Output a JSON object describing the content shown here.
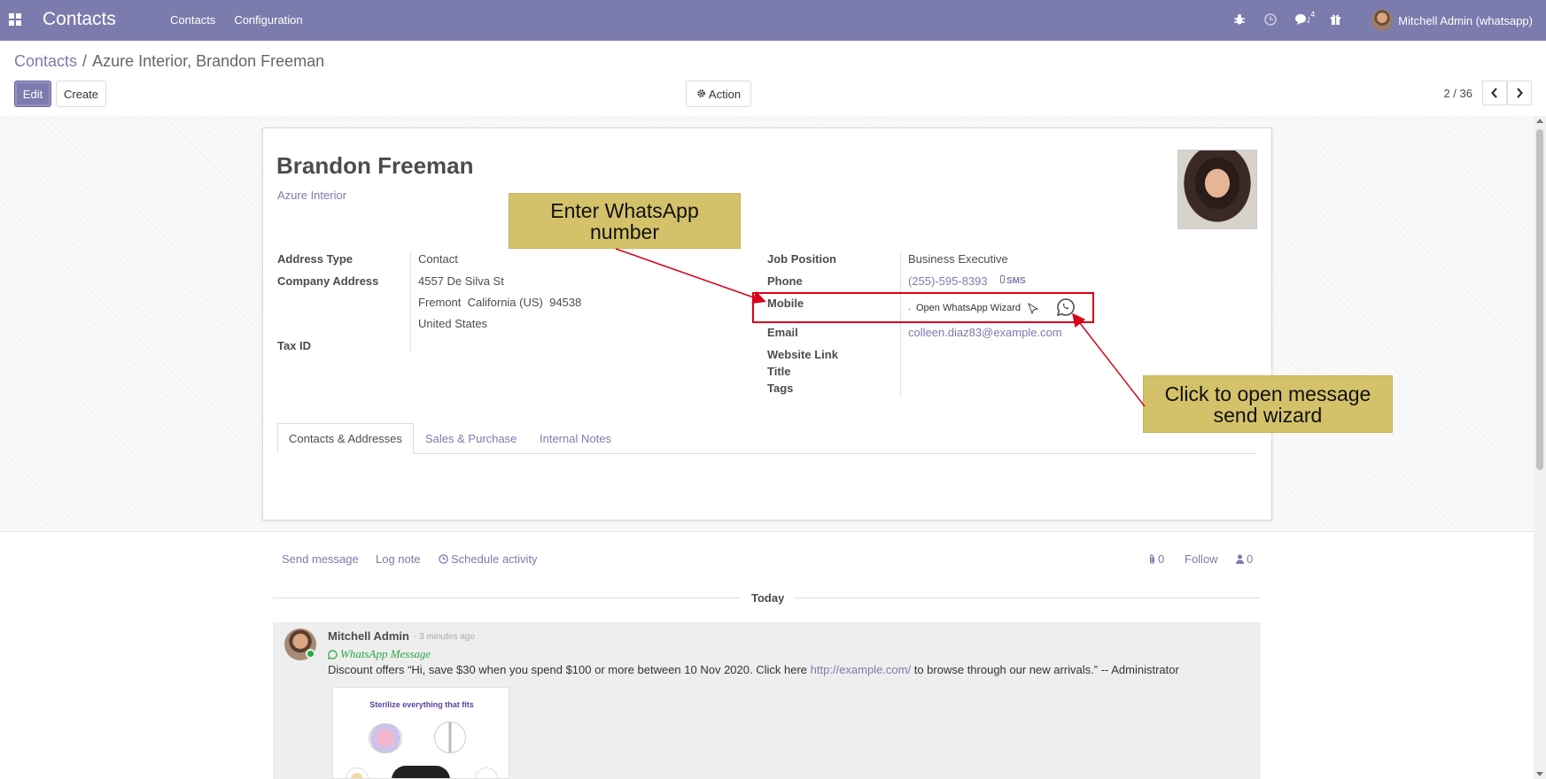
{
  "navbar": {
    "app_name": "Contacts",
    "menu": [
      "Contacts",
      "Configuration"
    ],
    "messages_count": "4",
    "user_name": "Mitchell Admin (whatsapp)"
  },
  "control_panel": {
    "breadcrumb_root": "Contacts",
    "breadcrumb_separator": "/",
    "breadcrumb_current": "Azure Interior, Brandon Freeman",
    "edit_label": "Edit",
    "create_label": "Create",
    "action_label": "Action",
    "pager": "2 / 36"
  },
  "form": {
    "name": "Brandon Freeman",
    "company": "Azure Interior",
    "left_fields": {
      "address_type_label": "Address Type",
      "address_type_value": "Contact",
      "company_address_label": "Company Address",
      "street": "4557 De Silva St",
      "city_line": "Fremont  California (US)  94538",
      "country": "United States",
      "tax_id_label": "Tax ID"
    },
    "right_fields": {
      "job_position_label": "Job Position",
      "job_position_value": "Business Executive",
      "phone_label": "Phone",
      "phone_value": "(255)-595-8393",
      "sms_label": "SMS",
      "mobile_label": "Mobile",
      "mobile_prefix": ".",
      "open_whatsapp_wizard": "Open WhatsApp Wizard",
      "email_label": "Email",
      "email_value": "colleen.diaz83@example.com",
      "website_label": "Website Link",
      "title_label": "Title",
      "tags_label": "Tags"
    },
    "tabs": [
      "Contacts & Addresses",
      "Sales & Purchase",
      "Internal Notes"
    ]
  },
  "callouts": {
    "enter_number": "Enter WhatsApp number",
    "click_wizard": "Click to open message send wizard"
  },
  "chatter": {
    "send_message": "Send message",
    "log_note": "Log note",
    "schedule_activity": "Schedule activity",
    "attachments_count": "0",
    "follow_label": "Follow",
    "followers_count": "0",
    "today_label": "Today",
    "message": {
      "author": "Mitchell Admin",
      "time": "- 3 minutes ago",
      "subtype": "WhatsApp Message",
      "body_before": "Discount offers “Hi, save $30 when you spend $100 or more between 10 Nov 2020. Click here",
      "body_link": "http://example.com/",
      "body_after": "to browse through our new arrivals.” -- Administrator",
      "attachment_title": "Sterilize everything that fits"
    }
  },
  "colors": {
    "brand": "#7c7bad",
    "callout": "#d4c26a",
    "highlight": "#d9001b",
    "whatsapp": "#28a745"
  }
}
